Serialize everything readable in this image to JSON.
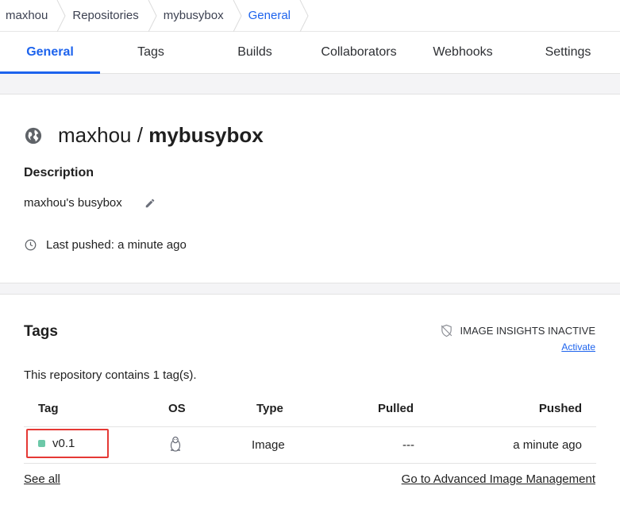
{
  "breadcrumb": [
    "maxhou",
    "Repositories",
    "mybusybox",
    "General"
  ],
  "tabs": [
    {
      "label": "General",
      "active": true
    },
    {
      "label": "Tags",
      "active": false
    },
    {
      "label": "Builds",
      "active": false
    },
    {
      "label": "Collaborators",
      "active": false
    },
    {
      "label": "Webhooks",
      "active": false
    },
    {
      "label": "Settings",
      "active": false
    }
  ],
  "repo": {
    "namespace": "maxhou",
    "separator": "/",
    "name": "mybusybox",
    "description_heading": "Description",
    "description": "maxhou's busybox",
    "last_pushed": "Last pushed: a minute ago"
  },
  "tags_section": {
    "heading": "Tags",
    "insights_label": "IMAGE INSIGHTS INACTIVE",
    "activate_link": "Activate",
    "count_text": "This repository contains 1 tag(s).",
    "columns": [
      "Tag",
      "OS",
      "Type",
      "Pulled",
      "Pushed"
    ],
    "rows": [
      {
        "tag": "v0.1",
        "os": "linux",
        "type": "Image",
        "pulled": "---",
        "pushed": "a minute ago"
      }
    ],
    "see_all": "See all",
    "advanced_link": "Go to Advanced Image Management"
  },
  "colors": {
    "accent": "#1d63ed",
    "tag_status": "#6cc8a8",
    "highlight_box": "#e53935"
  },
  "icons": {
    "visibility": "globe-icon",
    "edit": "pencil-icon",
    "time": "clock-icon",
    "insights": "shield-off-icon",
    "os": "linux-penguin-icon"
  }
}
